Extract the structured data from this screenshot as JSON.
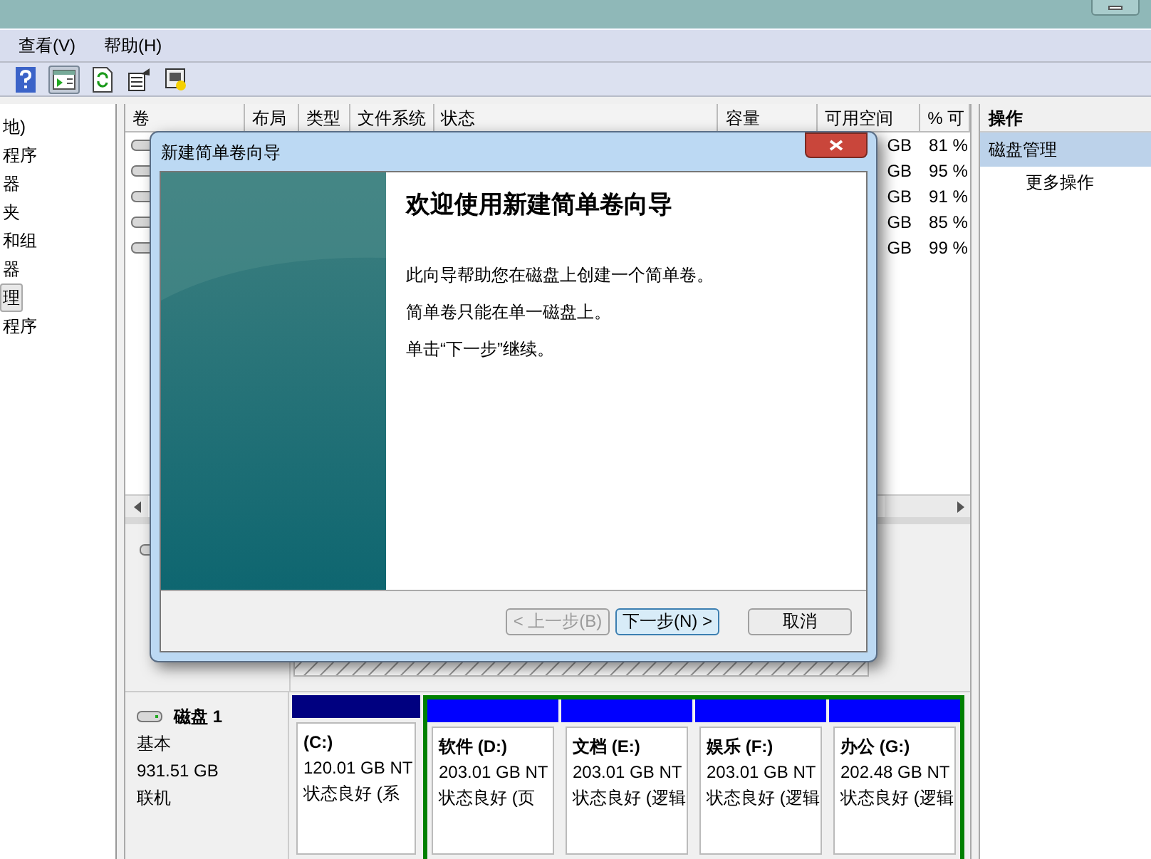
{
  "menu": [
    {
      "label": "查看(V)"
    },
    {
      "label": "帮助(H)"
    }
  ],
  "toolbar": [
    {
      "kind": "help",
      "pressed": false
    },
    {
      "kind": "console",
      "pressed": true
    },
    {
      "kind": "refresh",
      "pressed": false
    },
    {
      "kind": "properties",
      "pressed": false
    },
    {
      "kind": "export",
      "pressed": false
    }
  ],
  "tree": {
    "items": [
      {
        "label": "地)",
        "selected": false
      },
      {
        "label": "程序",
        "selected": false
      },
      {
        "label": "器",
        "selected": false
      },
      {
        "label": "夹",
        "selected": false
      },
      {
        "label": "和组",
        "selected": false
      },
      {
        "label": "器",
        "selected": false
      },
      {
        "label": "理",
        "selected": true
      },
      {
        "label": "程序",
        "selected": false
      }
    ]
  },
  "volume_table": {
    "columns": [
      "卷",
      "布局",
      "类型",
      "文件系统",
      "状态",
      "容量",
      "可用空间",
      "% 可"
    ],
    "rows": [
      {
        "free": "GB",
        "percent": "81 %"
      },
      {
        "free": "GB",
        "percent": "95 %"
      },
      {
        "free": "GB",
        "percent": "91 %"
      },
      {
        "free": "GB",
        "percent": "85 %"
      },
      {
        "free": "GB",
        "percent": "99 %"
      }
    ]
  },
  "disks": [
    {
      "label": "磁盘 1",
      "type": "基本",
      "size": "931.51 GB",
      "status": "联机",
      "partitions": [
        {
          "kind": "primary",
          "name": "(C:)",
          "size": "120.01 GB NT",
          "status": "状态良好 (系"
        },
        {
          "kind": "logical",
          "name": "软件 (D:)",
          "size": "203.01 GB NT",
          "status": "状态良好 (页"
        },
        {
          "kind": "logical",
          "name": "文档 (E:)",
          "size": "203.01 GB NT",
          "status": "状态良好 (逻辑"
        },
        {
          "kind": "logical",
          "name": "娱乐 (F:)",
          "size": "203.01 GB NT",
          "status": "状态良好 (逻辑"
        },
        {
          "kind": "logical",
          "name": "办公 (G:)",
          "size": "202.48 GB NT",
          "status": "状态良好 (逻辑"
        }
      ]
    }
  ],
  "actions": {
    "title": "操作",
    "items": [
      {
        "label": "磁盘管理",
        "selected": true
      },
      {
        "label": "更多操作",
        "selected": false
      }
    ]
  },
  "dialog": {
    "title": "新建简单卷向导",
    "heading": "欢迎使用新建简单卷向导",
    "paragraphs": [
      "此向导帮助您在磁盘上创建一个简单卷。",
      "简单卷只能在单一磁盘上。",
      "单击“下一步”继续。"
    ],
    "buttons": [
      {
        "label": "< 上一步(B)",
        "disabled": true,
        "default": false
      },
      {
        "label": "下一步(N) >",
        "disabled": false,
        "default": true
      },
      {
        "label": "取消",
        "disabled": false,
        "default": false
      }
    ]
  }
}
